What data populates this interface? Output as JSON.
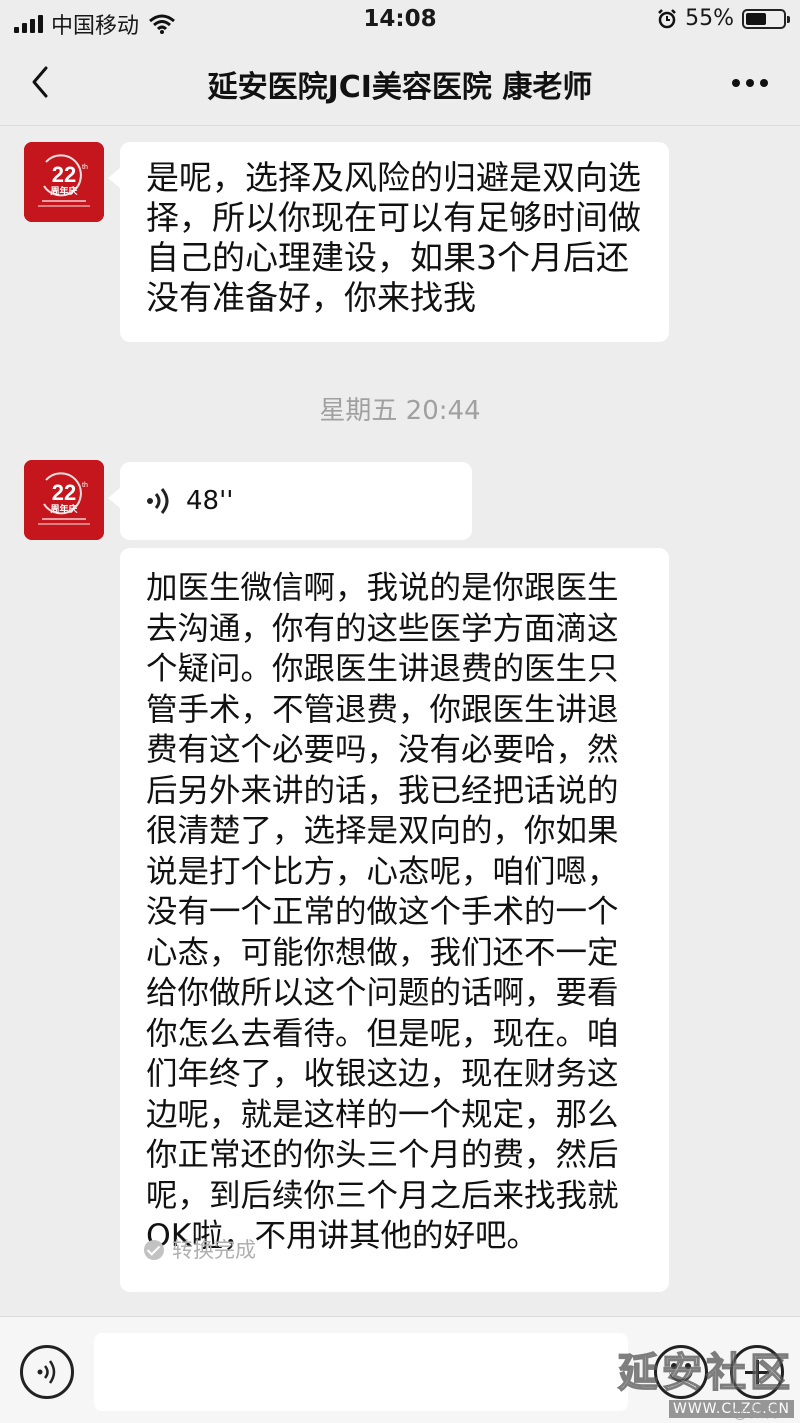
{
  "status_bar": {
    "carrier": "中国移动",
    "time": "14:08",
    "battery": "55%",
    "battery_level": 0.55
  },
  "nav": {
    "title": "延安医院JCI美容医院 康老师"
  },
  "avatar": {
    "number": "22",
    "suffix": "th",
    "caption": "周年庆"
  },
  "messages": {
    "first": "是呢，选择及风险的归避是双向选择，所以你现在可以有足够时间做自己的心理建设，如果3个月后还没有准备好，你来找我",
    "time_divider": "星期五 20:44",
    "voice_duration": "48''",
    "transcript": "加医生微信啊，我说的是你跟医生去沟通，你有的这些医学方面滴这个疑问。你跟医生讲退费的医生只管手术，不管退费，你跟医生讲退费有这个必要吗，没有必要哈，然后另外来讲的话，我已经把话说的很清楚了，选择是双向的，你如果说是打个比方，心态呢，咱们嗯，没有一个正常的做这个手术的一个心态，可能你想做，我们还不一定给你做所以这个问题的话啊，要看你怎么去看待。但是呢，现在。咱们年终了，收银这边，现在财务这边呢，就是这样的一个规定，那么你正常还的你头三个月的费，然后呢，到后续你三个月之后来找我就OK啦，不用讲其他的好吧。",
    "converted_label": "转换完成"
  },
  "watermark": {
    "title": "延安社区",
    "url": "WWW.CLZC.CN",
    "weibo": "@微博"
  },
  "colors": {
    "background": "#ededed",
    "bubble": "#ffffff",
    "avatar": "#c4161c",
    "muted": "#a0a0a0"
  },
  "icons": [
    "back-arrow-icon",
    "more-dots-icon",
    "voice-wave-icon",
    "check-icon",
    "voice-input-icon",
    "emoji-icon",
    "plus-icon"
  ]
}
